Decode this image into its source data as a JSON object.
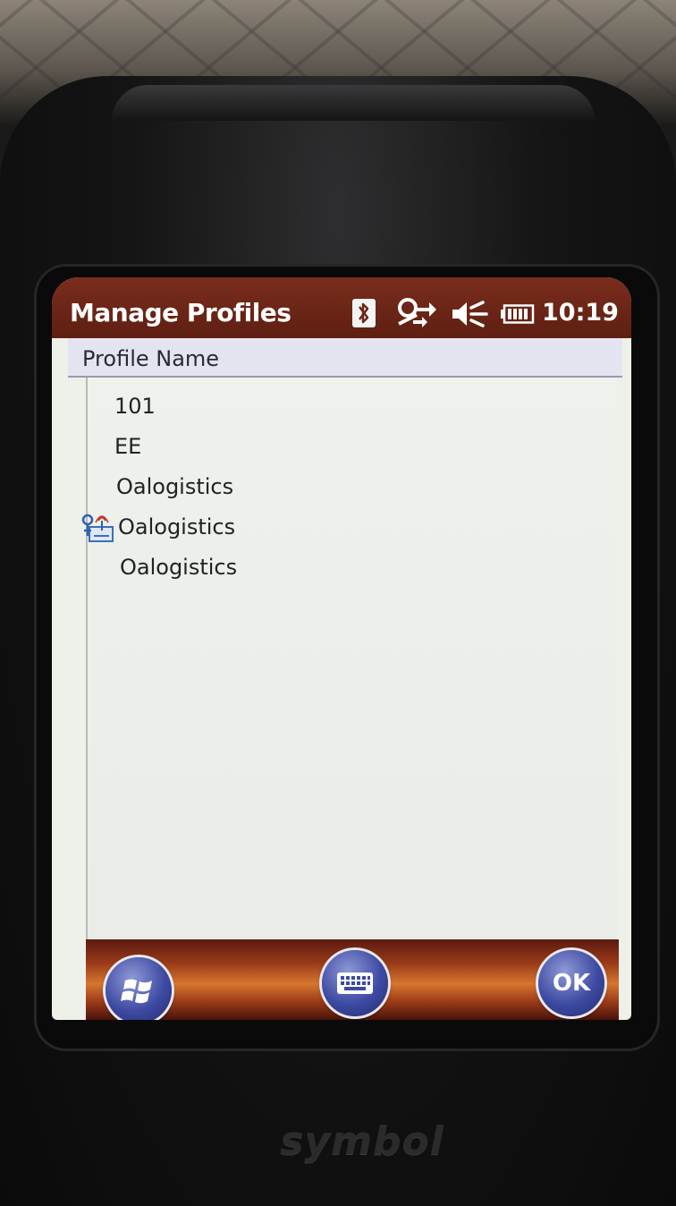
{
  "titlebar": {
    "title": "Manage Profiles",
    "clock": "10:19",
    "icons": [
      "bluetooth-icon",
      "connectivity-icon",
      "speaker-muted-icon",
      "battery-icon"
    ]
  },
  "list": {
    "header": "Profile Name",
    "items": [
      {
        "label": "101",
        "icon": null
      },
      {
        "label": "EE",
        "icon": null
      },
      {
        "label": "Oalogistics",
        "icon": null
      },
      {
        "label": "Oalogistics",
        "icon": "active-profile-icon"
      },
      {
        "label": "Oalogistics",
        "icon": null
      }
    ]
  },
  "bottombar": {
    "start_icon": "windows-start-icon",
    "keyboard_icon": "keyboard-icon",
    "ok_label": "OK"
  },
  "device": {
    "brand": "symbol"
  },
  "colors": {
    "titlebar": "#6b2616",
    "list_bg": "#eef0ea",
    "header_bg": "#e4e4f1",
    "button_blue": "#3d4aa2"
  }
}
